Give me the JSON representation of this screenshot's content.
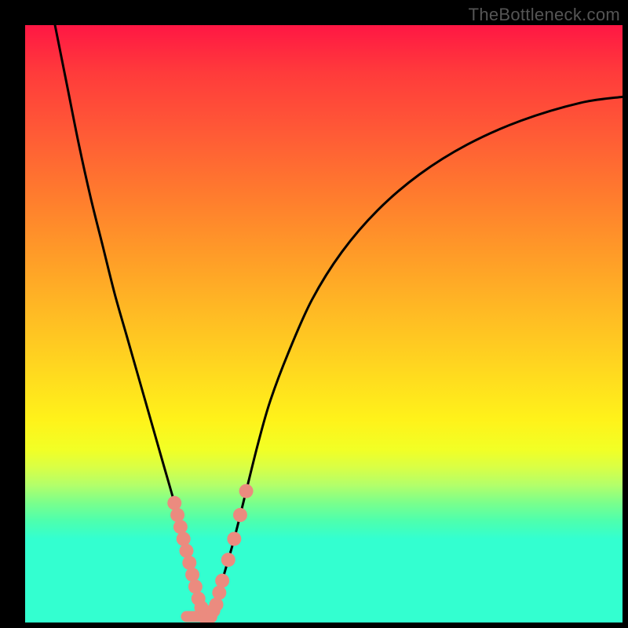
{
  "watermark": "TheBottleneck.com",
  "chart_data": {
    "type": "line",
    "title": "",
    "xlabel": "",
    "ylabel": "",
    "xlim": [
      0,
      100
    ],
    "ylim": [
      0,
      100
    ],
    "series": [
      {
        "name": "bottleneck-curve",
        "x": [
          5,
          7,
          9,
          11,
          13,
          15,
          17,
          19,
          21,
          23,
          25,
          26,
          27,
          28,
          29,
          30,
          31,
          32,
          33,
          35,
          37,
          39,
          41,
          44,
          48,
          53,
          59,
          66,
          74,
          83,
          93,
          100
        ],
        "values": [
          100,
          90,
          80,
          71,
          63,
          55,
          48,
          41,
          34,
          27,
          20,
          16,
          12,
          8,
          4,
          1,
          1,
          3,
          7,
          14,
          22,
          30,
          37,
          45,
          54,
          62,
          69,
          75,
          80,
          84,
          87,
          88
        ]
      }
    ],
    "markers": {
      "note": "salmon dots along the curve near the valley",
      "color": "#eb8b7f",
      "approx_points_index_range": [
        10,
        20
      ]
    },
    "flat_valley": {
      "note": "short horizontal segment at the very bottom of the V",
      "x_range": [
        27,
        30
      ],
      "y": 1
    }
  }
}
